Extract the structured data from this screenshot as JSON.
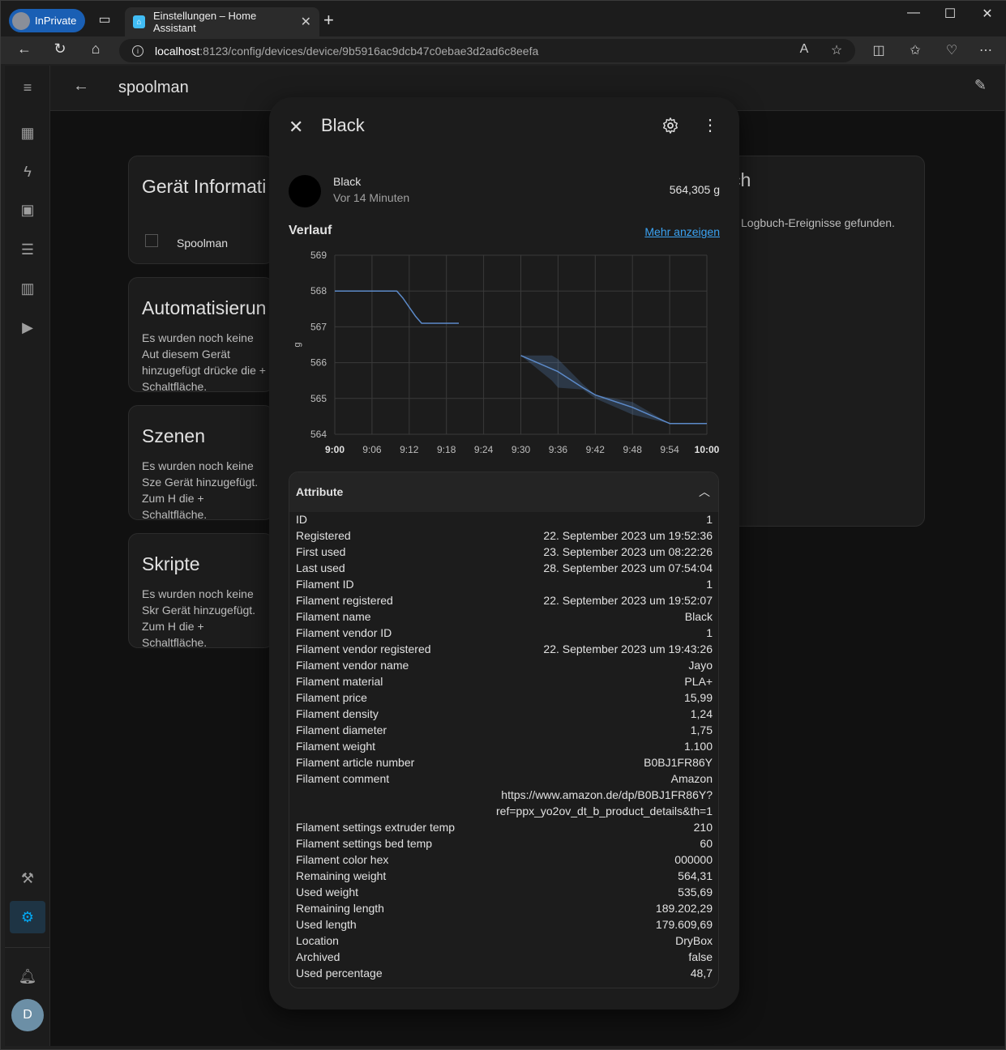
{
  "browser": {
    "inprivate_label": "InPrivate",
    "tab_title": "Einstellungen – Home Assistant",
    "url_host": "localhost",
    "url_rest": ":8123/config/devices/device/9b5916ac9dcb47c0ebae3d2ad6c8eefa"
  },
  "topbar": {
    "title": "spoolman"
  },
  "cards": {
    "device_info": {
      "title": "Gerät Informati",
      "item": "Spoolman"
    },
    "automations": {
      "title": "Automatisierun",
      "text": "Es wurden noch keine Aut diesem Gerät hinzugefügt drücke die + Schaltfläche."
    },
    "scenes": {
      "title": "Szenen",
      "text": "Es wurden noch keine Sze Gerät hinzugefügt. Zum H die + Schaltfläche."
    },
    "scripts": {
      "title": "Skripte",
      "text": "Es wurden noch keine Skr Gerät hinzugefügt. Zum H die + Schaltfläche."
    },
    "logbook": {
      "title": "ch",
      "text": "Logbuch-Ereignisse gefunden."
    }
  },
  "avatar_letter": "D",
  "dialog": {
    "title": "Black",
    "entity_name": "Black",
    "entity_time": "Vor 14 Minuten",
    "entity_state": "564,305 g",
    "history_title": "Verlauf",
    "more_link": "Mehr anzeigen",
    "attributes_title": "Attribute"
  },
  "chart_data": {
    "type": "line",
    "ylabel": "g",
    "ylim": [
      564,
      569
    ],
    "y_ticks": [
      "569",
      "568",
      "567",
      "566",
      "565",
      "564"
    ],
    "x_ticks": [
      "9:00",
      "9:06",
      "9:12",
      "9:18",
      "9:24",
      "9:30",
      "9:36",
      "9:42",
      "9:48",
      "9:54",
      "10:00"
    ],
    "grid": true,
    "series": [
      {
        "segment": 1,
        "x": [
          "9:00",
          "9:10",
          "9:11",
          "9:13",
          "9:14",
          "9:20"
        ],
        "values": [
          568.0,
          568.0,
          567.8,
          567.3,
          567.1,
          567.1
        ]
      },
      {
        "segment": 2,
        "x": [
          "9:30",
          "9:36",
          "9:40",
          "9:42",
          "9:48",
          "9:54",
          "10:00"
        ],
        "values": [
          566.2,
          565.75,
          565.3,
          565.1,
          564.75,
          564.3,
          564.3
        ]
      }
    ],
    "band": {
      "x": [
        "9:30",
        "9:35",
        "9:36",
        "9:40",
        "9:42",
        "9:48",
        "9:54",
        "10:00"
      ],
      "upper": [
        566.2,
        566.2,
        566.1,
        565.4,
        565.1,
        564.9,
        564.3,
        564.3
      ],
      "lower": [
        566.2,
        565.5,
        565.3,
        565.25,
        565.0,
        564.55,
        564.3,
        564.3
      ]
    }
  },
  "attributes": [
    {
      "key": "ID",
      "value": "1"
    },
    {
      "key": "Registered",
      "value": "22. September 2023 um 19:52:36"
    },
    {
      "key": "First used",
      "value": "23. September 2023 um 08:22:26"
    },
    {
      "key": "Last used",
      "value": "28. September 2023 um 07:54:04"
    },
    {
      "key": "Filament ID",
      "value": "1"
    },
    {
      "key": "Filament registered",
      "value": "22. September 2023 um 19:52:07"
    },
    {
      "key": "Filament name",
      "value": "Black"
    },
    {
      "key": "Filament vendor ID",
      "value": "1"
    },
    {
      "key": "Filament vendor registered",
      "value": "22. September 2023 um 19:43:26"
    },
    {
      "key": "Filament vendor name",
      "value": "Jayo"
    },
    {
      "key": "Filament material",
      "value": "PLA+"
    },
    {
      "key": "Filament price",
      "value": "15,99"
    },
    {
      "key": "Filament density",
      "value": "1,24"
    },
    {
      "key": "Filament diameter",
      "value": "1,75"
    },
    {
      "key": "Filament weight",
      "value": "1.100"
    },
    {
      "key": "Filament article number",
      "value": "B0BJ1FR86Y"
    },
    {
      "key": "Filament comment",
      "value": "Amazon https://www.amazon.de/dp/B0BJ1FR86Y?ref=ppx_yo2ov_dt_b_product_details&th=1"
    },
    {
      "key": "Filament settings extruder temp",
      "value": "210"
    },
    {
      "key": "Filament settings bed temp",
      "value": "60"
    },
    {
      "key": "Filament color hex",
      "value": "000000"
    },
    {
      "key": "Remaining weight",
      "value": "564,31"
    },
    {
      "key": "Used weight",
      "value": "535,69"
    },
    {
      "key": "Remaining length",
      "value": "189.202,29"
    },
    {
      "key": "Used length",
      "value": "179.609,69"
    },
    {
      "key": "Location",
      "value": "DryBox"
    },
    {
      "key": "Archived",
      "value": "false"
    },
    {
      "key": "Used percentage",
      "value": "48,7"
    }
  ],
  "colors": {
    "accent": "#03a9f4",
    "link": "#3ba3f3",
    "line": "#5c8ac9"
  }
}
